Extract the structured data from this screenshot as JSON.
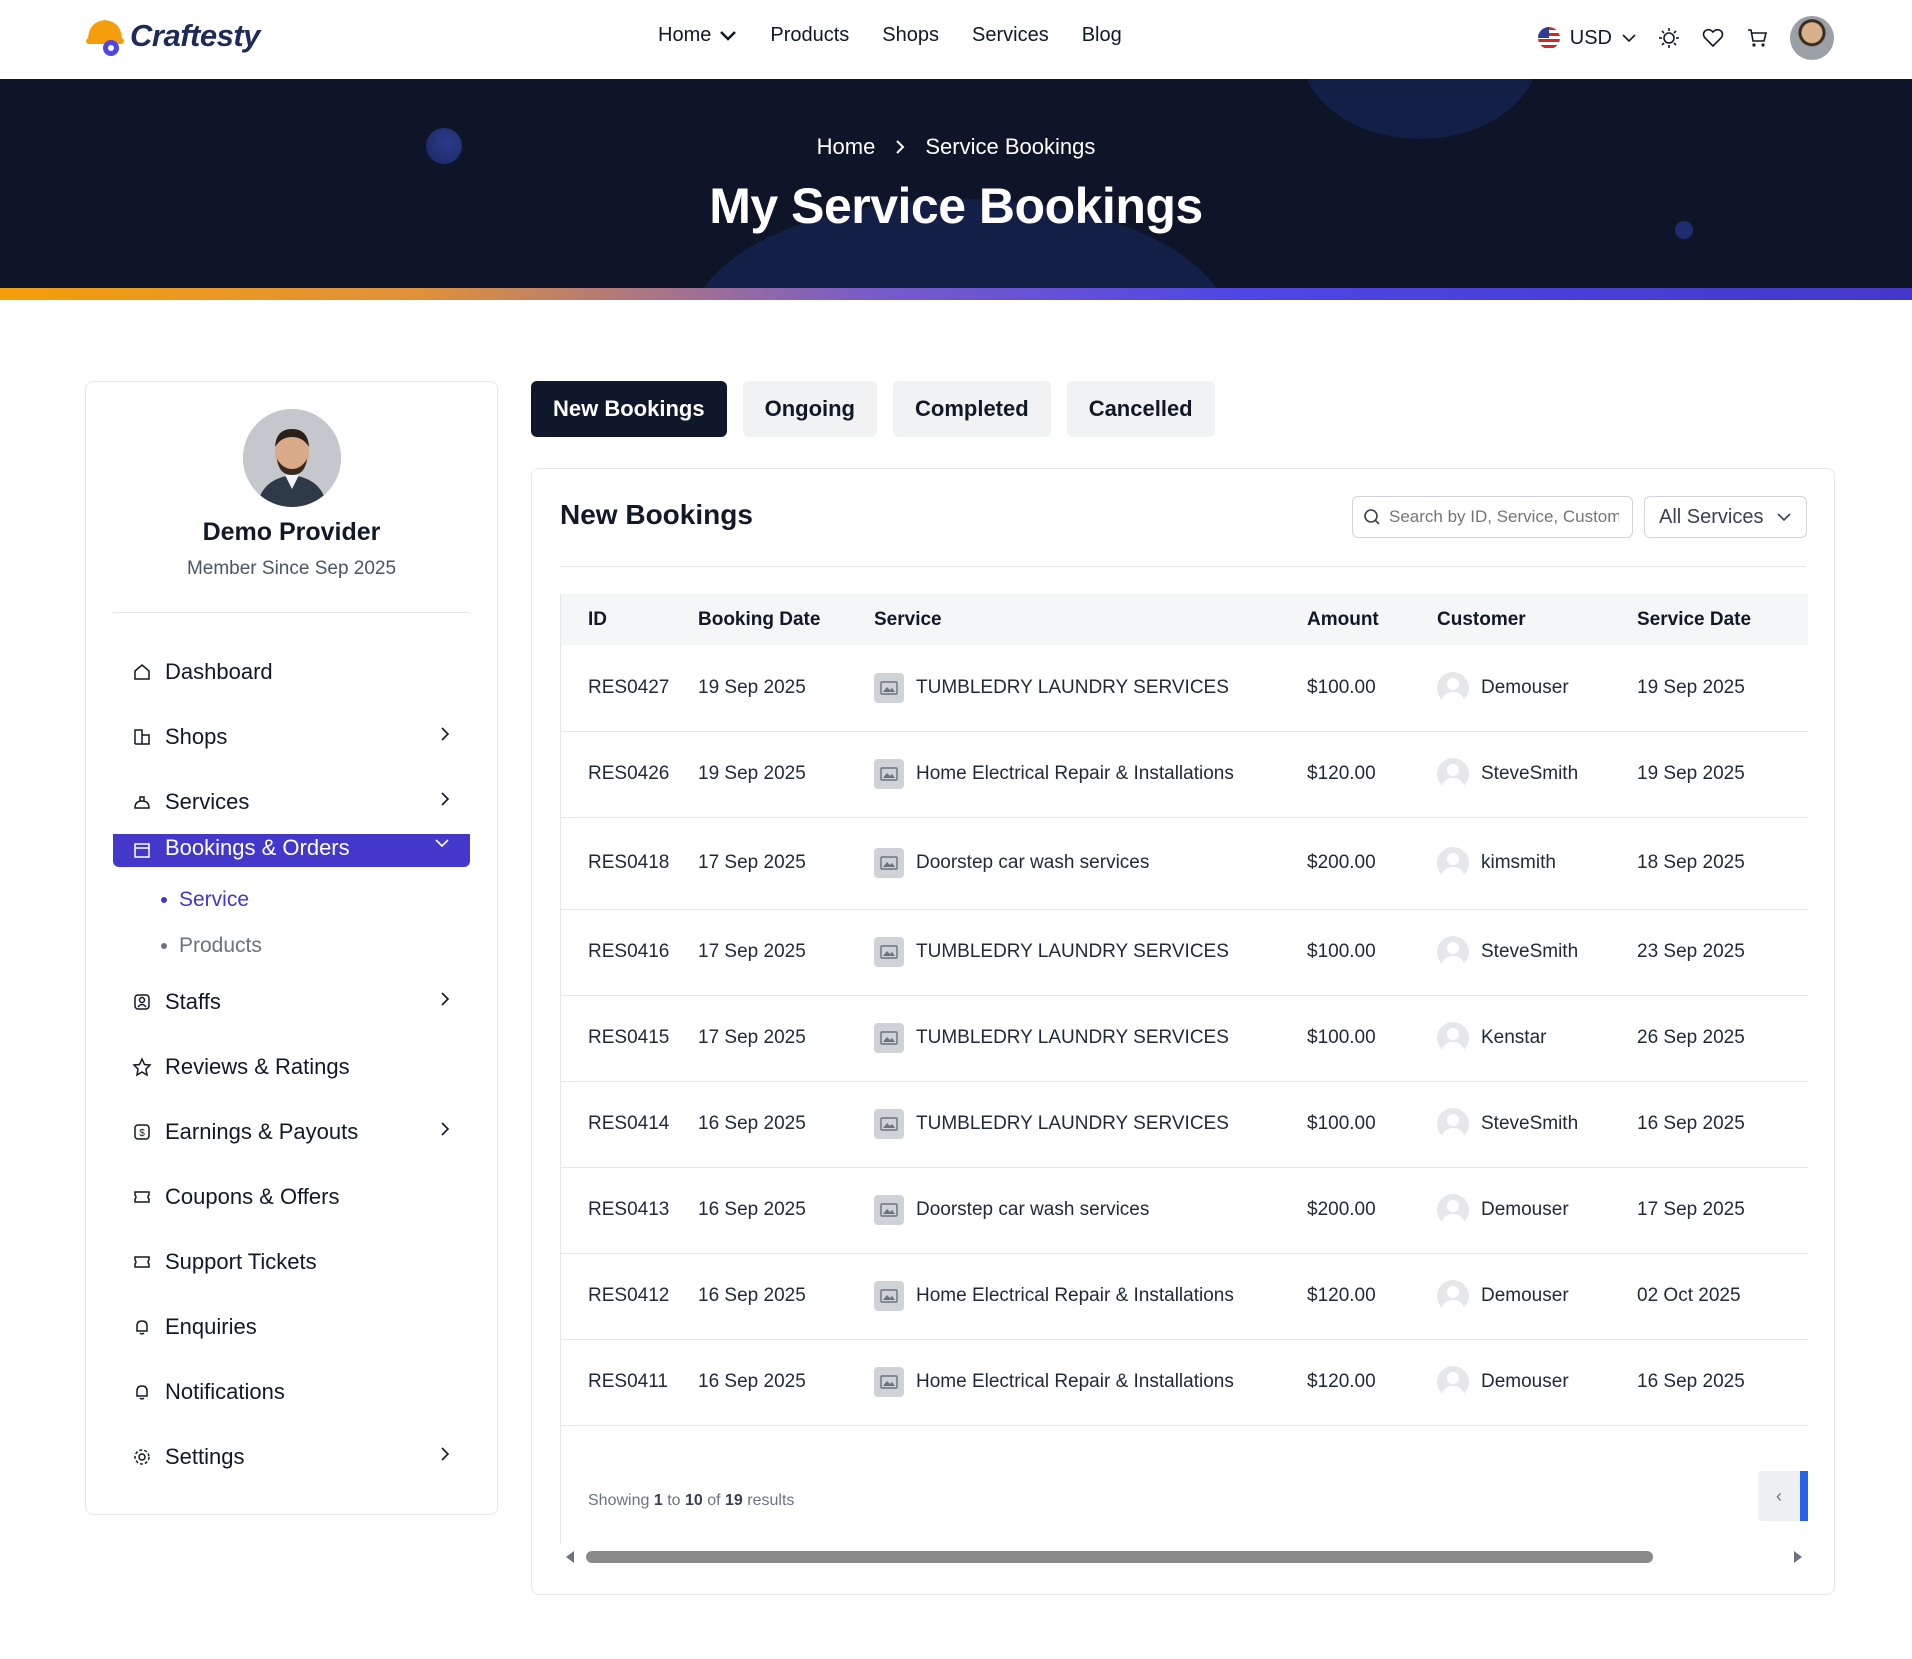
{
  "brand": {
    "name": "Craftesty"
  },
  "nav": {
    "links": [
      "Home",
      "Products",
      "Shops",
      "Services",
      "Blog"
    ],
    "currency": "USD"
  },
  "hero": {
    "breadcrumb": [
      "Home",
      "Service Bookings"
    ],
    "title": "My Service Bookings"
  },
  "sidebar": {
    "name": "Demo Provider",
    "since": "Member Since Sep 2025",
    "items": [
      {
        "label": "Dashboard",
        "icon": "home-icon",
        "chevron": false
      },
      {
        "label": "Shops",
        "icon": "shop-icon",
        "chevron": true
      },
      {
        "label": "Services",
        "icon": "services-icon",
        "chevron": true
      },
      {
        "label": "Bookings & Orders",
        "icon": "bookings-icon",
        "chevron": true,
        "active": true
      },
      {
        "label": "Staffs",
        "icon": "staff-icon",
        "chevron": true
      },
      {
        "label": "Reviews & Ratings",
        "icon": "star-icon",
        "chevron": false
      },
      {
        "label": "Earnings & Payouts",
        "icon": "dollar-icon",
        "chevron": true
      },
      {
        "label": "Coupons & Offers",
        "icon": "coupon-icon",
        "chevron": false
      },
      {
        "label": "Support Tickets",
        "icon": "ticket-icon",
        "chevron": false
      },
      {
        "label": "Enquiries",
        "icon": "bell-icon",
        "chevron": false
      },
      {
        "label": "Notifications",
        "icon": "bell-icon",
        "chevron": false
      },
      {
        "label": "Settings",
        "icon": "gear-icon",
        "chevron": true
      }
    ],
    "submenu": [
      "Service",
      "Products"
    ]
  },
  "tabs": [
    "New Bookings",
    "Ongoing",
    "Completed",
    "Cancelled"
  ],
  "card": {
    "title": "New Bookings",
    "search_placeholder": "Search by ID, Service, Customer",
    "filter": "All Services"
  },
  "table": {
    "headers": [
      "ID",
      "Booking Date",
      "Service",
      "Amount",
      "Customer",
      "Service Date"
    ],
    "rows": [
      [
        "RES0427",
        "19 Sep 2025",
        "TUMBLEDRY LAUNDRY SERVICES",
        "$100.00",
        "Demouser",
        "19 Sep 2025"
      ],
      [
        "RES0426",
        "19 Sep 2025",
        "Home Electrical Repair & Installations",
        "$120.00",
        "SteveSmith",
        "19 Sep 2025"
      ],
      [
        "RES0418",
        "17 Sep 2025",
        "Doorstep car wash services",
        "$200.00",
        "kimsmith",
        "18 Sep 2025"
      ],
      [
        "RES0416",
        "17 Sep 2025",
        "TUMBLEDRY LAUNDRY SERVICES",
        "$100.00",
        "SteveSmith",
        "23 Sep 2025"
      ],
      [
        "RES0415",
        "17 Sep 2025",
        "TUMBLEDRY LAUNDRY SERVICES",
        "$100.00",
        "Kenstar",
        "26 Sep 2025"
      ],
      [
        "RES0414",
        "16 Sep 2025",
        "TUMBLEDRY LAUNDRY SERVICES",
        "$100.00",
        "SteveSmith",
        "16 Sep 2025"
      ],
      [
        "RES0413",
        "16 Sep 2025",
        "Doorstep car wash services",
        "$200.00",
        "Demouser",
        "17 Sep 2025"
      ],
      [
        "RES0412",
        "16 Sep 2025",
        "Home Electrical Repair & Installations",
        "$120.00",
        "Demouser",
        "02 Oct 2025"
      ],
      [
        "RES0411",
        "16 Sep 2025",
        "Home Electrical Repair & Installations",
        "$120.00",
        "Demouser",
        "16 Sep 2025"
      ]
    ]
  },
  "pagination": {
    "prefix": "Showing",
    "from": "1",
    "to_word": "to",
    "to": "10",
    "of_word": "of",
    "total": "19",
    "suffix": "results",
    "prev_label": "‹"
  },
  "colors": {
    "accent": "#4338ca",
    "hero_bg": "#0e1528",
    "tab_active": "#0f172a"
  }
}
